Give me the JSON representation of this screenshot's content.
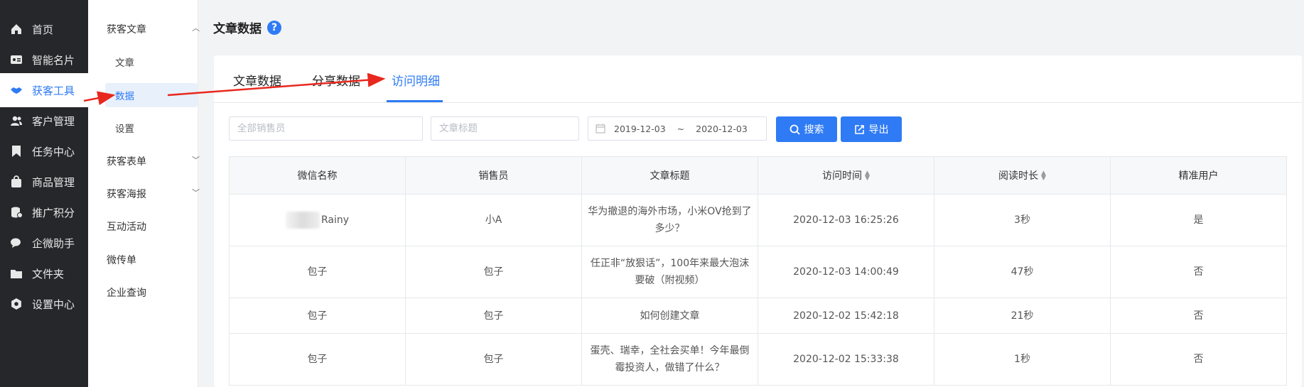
{
  "nav": {
    "items": [
      {
        "label": "首页",
        "icon": "home-icon"
      },
      {
        "label": "智能名片",
        "icon": "card-icon"
      },
      {
        "label": "获客工具",
        "icon": "handshake-icon"
      },
      {
        "label": "客户管理",
        "icon": "users-icon"
      },
      {
        "label": "任务中心",
        "icon": "bookmark-icon"
      },
      {
        "label": "商品管理",
        "icon": "bag-icon"
      },
      {
        "label": "推广积分",
        "icon": "coins-icon"
      },
      {
        "label": "企微助手",
        "icon": "chat-icon"
      },
      {
        "label": "文件夹",
        "icon": "folder-icon"
      },
      {
        "label": "设置中心",
        "icon": "gear-icon"
      }
    ],
    "active_index": 2
  },
  "submenu": {
    "group1": "获客文章",
    "group1_children": [
      "文章",
      "数据",
      "设置"
    ],
    "group2": "获客表单",
    "group3": "获客海报",
    "item4": "互动活动",
    "item5": "微传单",
    "item6": "企业查询"
  },
  "page": {
    "title": "文章数据",
    "help": "?"
  },
  "tabs": [
    "文章数据",
    "分享数据",
    "访问明细"
  ],
  "active_tab": 2,
  "filters": {
    "salesperson_placeholder": "全部销售员",
    "title_placeholder": "文章标题",
    "date_from": "2019-12-03",
    "date_sep": "~",
    "date_to": "2020-12-03",
    "search_label": "搜索",
    "export_label": "导出"
  },
  "table": {
    "headers": [
      "微信名称",
      "销售员",
      "文章标题",
      "访问时间",
      "阅读时长",
      "精准用户"
    ],
    "rows": [
      {
        "wechat": "Rainy",
        "sales": "小A",
        "title": "华为撤退的海外市场，小米OV抢到了多少？",
        "time": "2020-12-03 16:25:26",
        "duration": "3秒",
        "precise": "是"
      },
      {
        "wechat": "包子",
        "sales": "包子",
        "title": "任正非“放狠话”，100年来最大泡沫要破（附视频）",
        "time": "2020-12-03 14:00:49",
        "duration": "47秒",
        "precise": "否"
      },
      {
        "wechat": "包子",
        "sales": "包子",
        "title": "如何创建文章",
        "time": "2020-12-02 15:42:18",
        "duration": "21秒",
        "precise": "否"
      },
      {
        "wechat": "包子",
        "sales": "包子",
        "title": "蛋壳、瑞幸，全社会买单！今年最倒霉投资人，做错了什么？",
        "time": "2020-12-02 15:33:38",
        "duration": "1秒",
        "precise": "否"
      }
    ]
  },
  "colors": {
    "accent": "#2f7bf5",
    "nav_bg": "#25272b",
    "arrow": "#e8281e"
  }
}
